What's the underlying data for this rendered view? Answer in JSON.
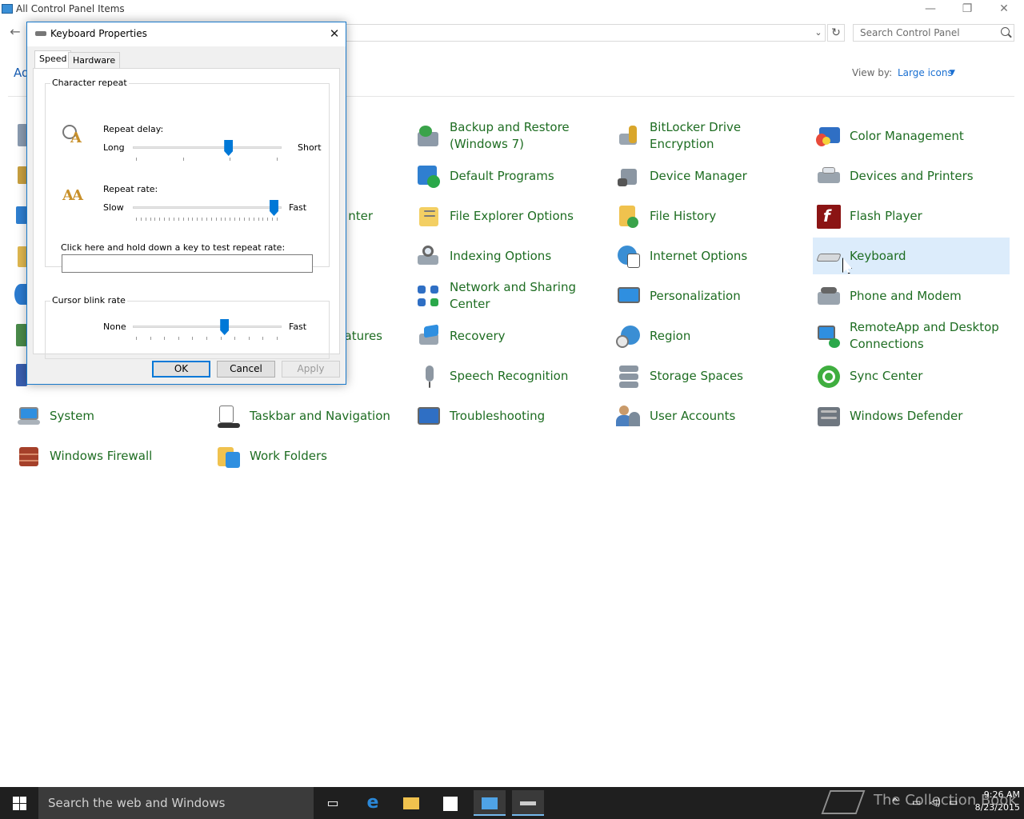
{
  "window": {
    "title": "All Control Panel Items",
    "minimize": "—",
    "restore": "❐",
    "close": "✕"
  },
  "nav": {
    "back": "←",
    "search_placeholder": "Search Control Panel",
    "addr_caret": "⌄",
    "refresh": "↻"
  },
  "header": {
    "adjust_partial": "Ad",
    "view_by_label": "View by:",
    "view_by_value": "Large icons",
    "view_by_caret": "▼"
  },
  "items": [
    {
      "label": "Backup and Restore (Windows 7)",
      "icon": "backup-icon"
    },
    {
      "label": "BitLocker Drive Encryption",
      "icon": "bitlocker-icon"
    },
    {
      "label": "Color Management",
      "icon": "color-management-icon"
    },
    {
      "label": "Default Programs",
      "icon": "default-programs-icon"
    },
    {
      "label": "Device Manager",
      "icon": "device-manager-icon"
    },
    {
      "label": "Devices and Printers",
      "icon": "printer-icon"
    },
    {
      "label": "nter",
      "icon": ""
    },
    {
      "label": "File Explorer Options",
      "icon": "folder-options-icon"
    },
    {
      "label": "File History",
      "icon": "file-history-icon"
    },
    {
      "label": "Flash Player",
      "icon": "flash-icon"
    },
    {
      "label": "Indexing Options",
      "icon": "indexing-icon"
    },
    {
      "label": "Internet Options",
      "icon": "internet-options-icon"
    },
    {
      "label": "Keyboard",
      "icon": "keyboard-icon"
    },
    {
      "label": "Network and Sharing Center",
      "icon": "network-icon"
    },
    {
      "label": "Personalization",
      "icon": "personalization-icon"
    },
    {
      "label": "Phone and Modem",
      "icon": "phone-icon"
    },
    {
      "label": "atures",
      "icon": ""
    },
    {
      "label": "Recovery",
      "icon": "recovery-icon"
    },
    {
      "label": "Region",
      "icon": "region-icon"
    },
    {
      "label": "RemoteApp and Desktop Connections",
      "icon": "remoteapp-icon"
    },
    {
      "label": "Speech Recognition",
      "icon": "microphone-icon"
    },
    {
      "label": "Storage Spaces",
      "icon": "storage-icon"
    },
    {
      "label": "Sync Center",
      "icon": "sync-icon"
    },
    {
      "label": "System",
      "icon": "system-icon"
    },
    {
      "label": "Taskbar and Navigation",
      "icon": "taskbar-icon"
    },
    {
      "label": "Troubleshooting",
      "icon": "troubleshooting-icon"
    },
    {
      "label": "User Accounts",
      "icon": "users-icon"
    },
    {
      "label": "Windows Defender",
      "icon": "defender-icon"
    },
    {
      "label": "Windows Firewall",
      "icon": "firewall-icon"
    },
    {
      "label": "Work Folders",
      "icon": "work-folders-icon"
    }
  ],
  "dialog": {
    "title": "Keyboard Properties",
    "close": "✕",
    "tabs": [
      "Speed",
      "Hardware"
    ],
    "char_repeat_group": "Character repeat",
    "repeat_delay_label": "Repeat delay:",
    "delay_low": "Long",
    "delay_high": "Short",
    "repeat_delay_level": 0.66,
    "repeat_rate_label": "Repeat rate:",
    "rate_low": "Slow",
    "rate_high": "Fast",
    "repeat_rate_level": 1.0,
    "test_label": "Click here and hold down a key to test repeat rate:",
    "test_value": "",
    "blink_group": "Cursor blink rate",
    "blink_low": "None",
    "blink_high": "Fast",
    "blink_level": 0.63,
    "ok": "OK",
    "cancel": "Cancel",
    "apply": "Apply"
  },
  "taskbar": {
    "search_text": "Search the web and Windows",
    "time": "9:26 AM",
    "date": "8/23/2015",
    "watermark": "The Collection Book"
  },
  "colors": {
    "link_green": "#1e6d22",
    "accent": "#0078d7",
    "selection": "#dcecfb"
  }
}
